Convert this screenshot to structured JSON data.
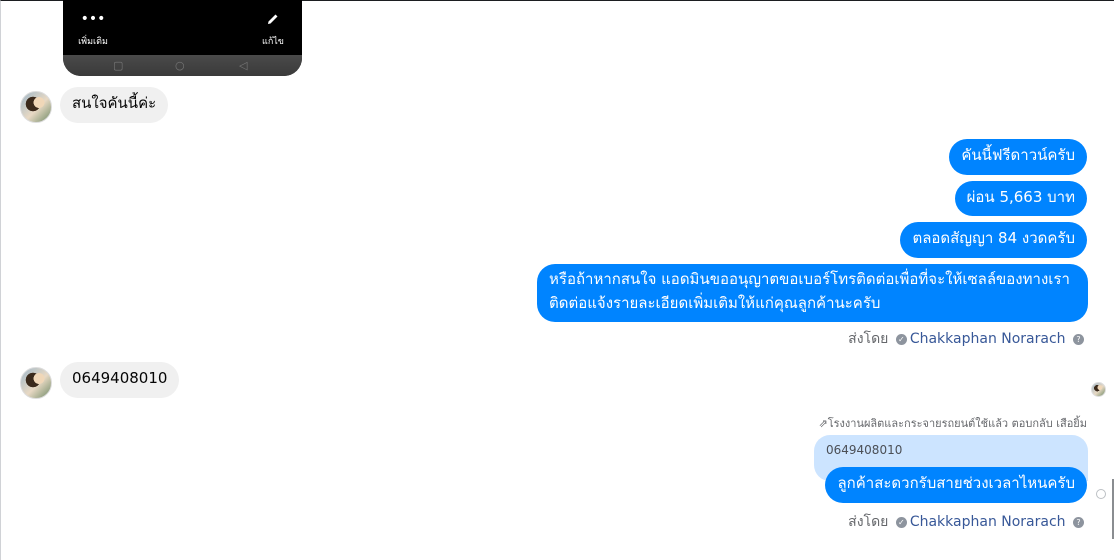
{
  "phone_preview": {
    "more_label": "เพิ่มเติม",
    "edit_label": "แก้ไข"
  },
  "messages": {
    "in_1": "สนใจคันนี้ค่ะ",
    "out_1": "คันนี้ฟรีดาวน์ครับ",
    "out_2": "ผ่อน 5,663 บาท",
    "out_3": "ตลอดสัญญา 84 งวดครับ",
    "out_4": "หรือถ้าหากสนใจ แอดมินขออนุญาตขอเบอร์โทรติดต่อเพื่อที่จะให้เซลล์ของทางเราติดต่อแจ้งรายละเอียดเพิ่มเติมให้แก่คุณลูกค้านะครับ",
    "in_2": "0649408010",
    "out_5": "ลูกค้าสะดวกรับสายช่วงเวลาไหนครับ"
  },
  "sent_by": {
    "prefix": "ส่งโดย",
    "name": "Chakkaphan Norarach",
    "help": "?"
  },
  "reply": {
    "context": "โรงงานผลิตและกระจายรถยนต์ใช้แล้ว ตอบกลับ เสือยิ้ม",
    "quoted_text": "0649408010"
  }
}
